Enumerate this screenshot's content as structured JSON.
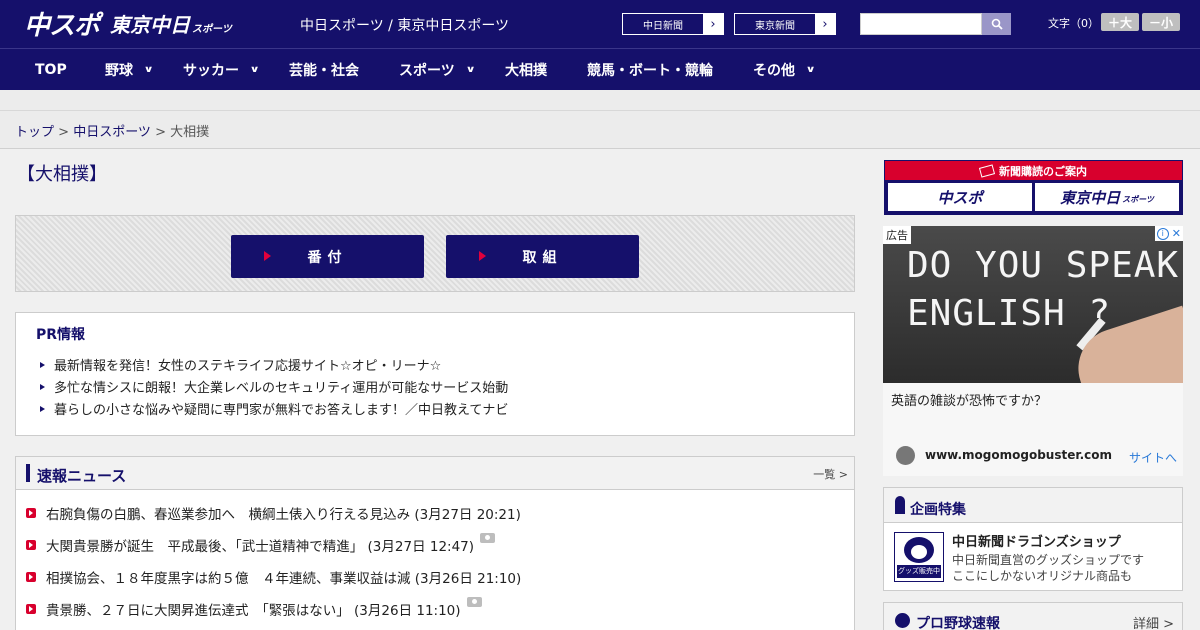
{
  "header": {
    "logo_chuspo": "中スポ",
    "logo_tokyo": "東京中日",
    "logo_tokyo_small": "スポーツ",
    "site_title": "中日スポーツ / 東京中日スポーツ",
    "link_chunichi": "中日新聞",
    "link_tokyo": "東京新聞",
    "search_placeholder": "",
    "fontsize_label": "文字（0）",
    "fontsize_up": "＋大",
    "fontsize_down": "－小"
  },
  "nav": [
    {
      "label": "TOP"
    },
    {
      "label": "野球"
    },
    {
      "label": "サッカー"
    },
    {
      "label": "芸能・社会"
    },
    {
      "label": "スポーツ"
    },
    {
      "label": "大相撲"
    },
    {
      "label": "競馬・ボート・競輪"
    },
    {
      "label": "その他"
    }
  ],
  "breadcrumb": {
    "top": "トップ",
    "sep1": " > ",
    "chuspo": "中日スポーツ",
    "sep2": " > ",
    "current": "大相撲"
  },
  "page_title": "【大相撲】",
  "sumo_buttons": {
    "banzuke": "番付",
    "torikumi": "取組"
  },
  "pr": {
    "title": "PR情報",
    "items": [
      "最新情報を発信！女性のステキライフ応援サイト☆オピ・リーナ☆",
      "多忙な情シスに朗報！大企業レベルのセキュリティ運用が可能なサービス始動",
      "暮らしの小さな悩みや疑問に専門家が無料でお答えします！／中日教えてナビ"
    ]
  },
  "news": {
    "title": "速報ニュース",
    "more": "一覧 >",
    "items": [
      "右腕負傷の白鵬、春巡業参加へ　横綱土俵入り行える見込み (3月27日 20:21)",
      "大関貴景勝が誕生　平成最後、「武士道精神で精進」 (3月27日 12:47)",
      "相撲協会、１８年度黒字は約５億　４年連続、事業収益は減 (3月26日 21:10)",
      "貴景勝、２７日に大関昇進伝達式　「緊張はない」 (3月26日 11:10)"
    ]
  },
  "subscription": {
    "head": "新聞購読のご案内",
    "logo_chuspo": "中スポ",
    "logo_tokyo": "東京中日",
    "logo_tokyo_small": "スポーツ"
  },
  "ad": {
    "tag": "広告",
    "image_text_line1": "DO YOU SPEAK",
    "image_text_line2": "ENGLISH ?",
    "headline": "英語の雑談が恐怖ですか？",
    "url": "www.mogomogobuster.com",
    "cta": "サイトへ"
  },
  "feature": {
    "title": "企画特集",
    "thumb_tag": "グッズ販売中",
    "shop_title": "中日新聞ドラゴンズショップ",
    "shop_desc1": "中日新聞直営のグッズショップです",
    "shop_desc2": "ここにしかないオリジナル商品も"
  },
  "baseball": {
    "title": "プロ野球速報",
    "more": "詳細 >"
  }
}
